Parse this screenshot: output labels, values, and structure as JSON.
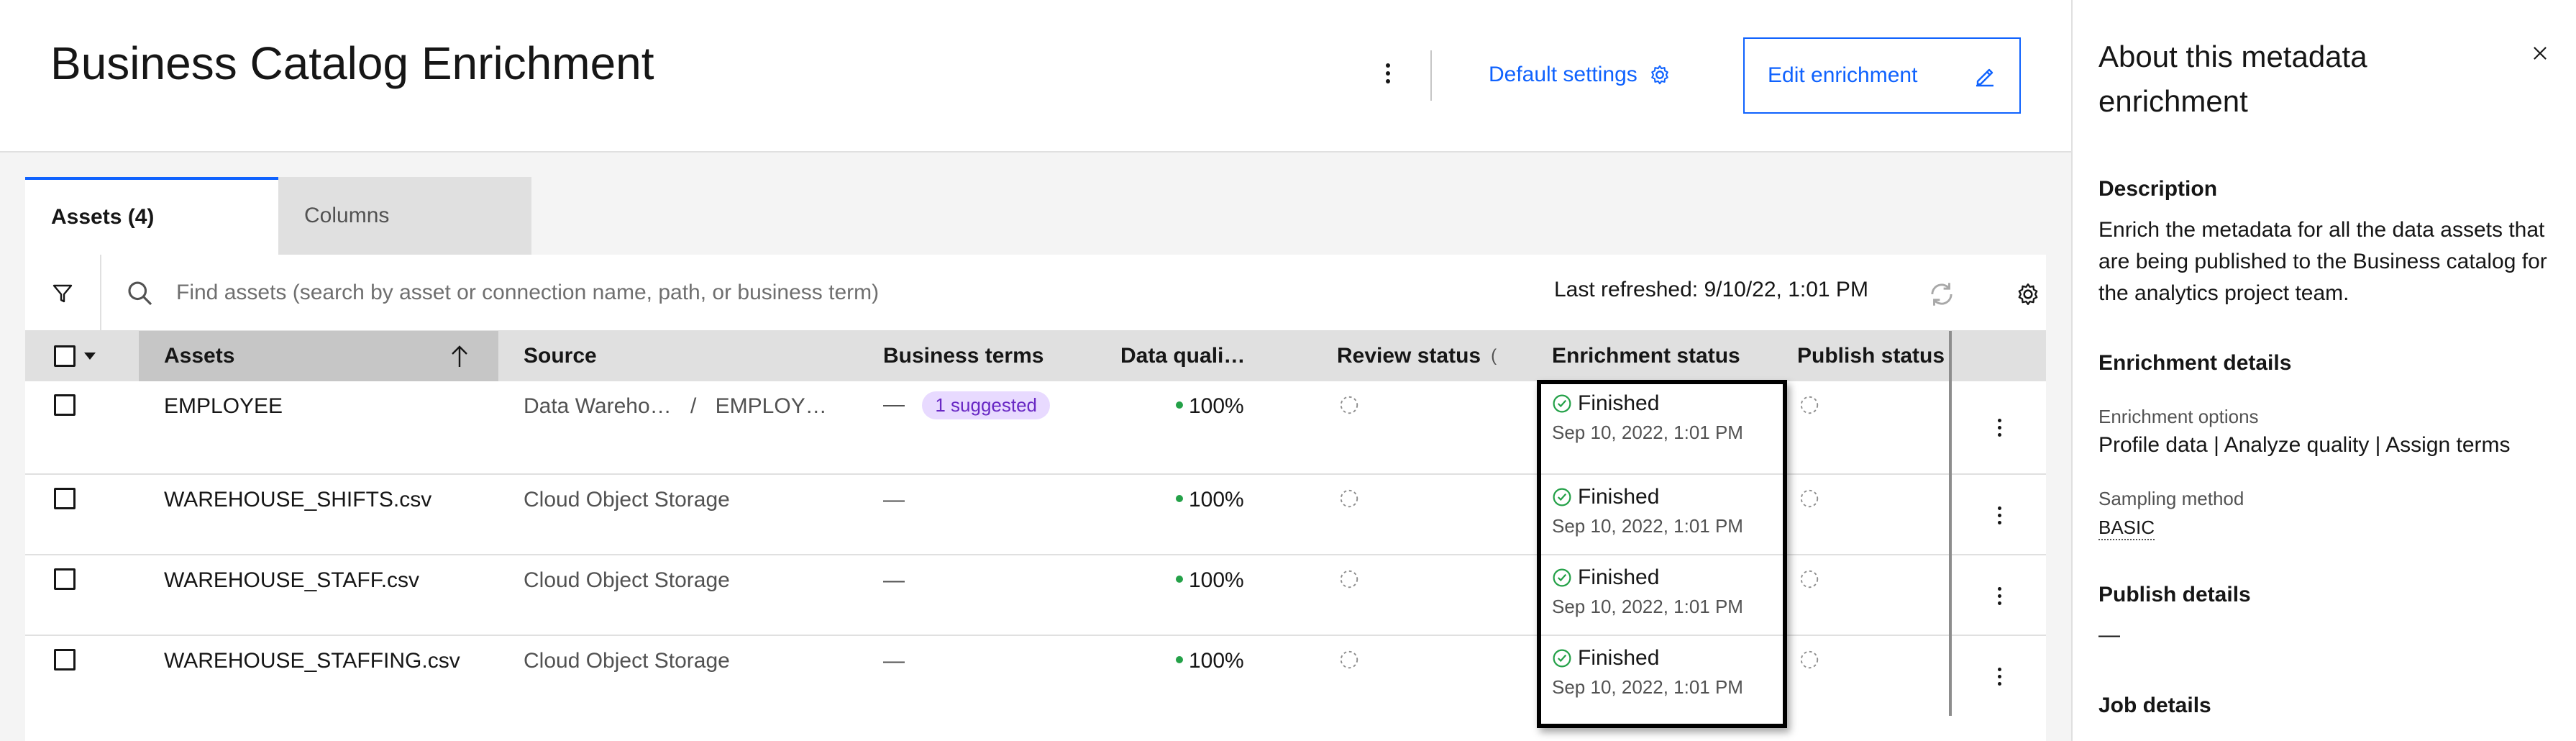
{
  "header": {
    "title": "Business Catalog Enrichment",
    "default_settings_label": "Default settings",
    "edit_label": "Edit enrichment"
  },
  "tabs": [
    {
      "label": "Assets (4)",
      "active": true
    },
    {
      "label": "Columns",
      "active": false
    }
  ],
  "toolbar": {
    "search_placeholder": "Find assets (search by asset or connection name, path, or business term)",
    "last_refreshed": "Last refreshed: 9/10/22, 1:01 PM"
  },
  "table": {
    "columns": {
      "assets": "Assets",
      "source": "Source",
      "business_terms": "Business terms",
      "data_quality": "Data quali…",
      "review_status": "Review status",
      "enrichment_status": "Enrichment status",
      "publish_status": "Publish status"
    },
    "rows": [
      {
        "asset": "EMPLOYEE",
        "source_a": "Data Wareho…",
        "source_sep": "/",
        "source_b": "EMPLOY…",
        "terms": "—",
        "terms_tag": "1 suggested",
        "quality": "100%",
        "enrichment": "Finished",
        "enrichment_time": "Sep 10, 2022, 1:01 PM"
      },
      {
        "asset": "WAREHOUSE_SHIFTS.csv",
        "source": "Cloud Object Storage",
        "terms": "—",
        "quality": "100%",
        "enrichment": "Finished",
        "enrichment_time": "Sep 10, 2022, 1:01 PM"
      },
      {
        "asset": "WAREHOUSE_STAFF.csv",
        "source": "Cloud Object Storage",
        "terms": "—",
        "quality": "100%",
        "enrichment": "Finished",
        "enrichment_time": "Sep 10, 2022, 1:01 PM"
      },
      {
        "asset": "WAREHOUSE_STAFFING.csv",
        "source": "Cloud Object Storage",
        "terms": "—",
        "quality": "100%",
        "enrichment": "Finished",
        "enrichment_time": "Sep 10, 2022, 1:01 PM"
      }
    ]
  },
  "panel": {
    "title": "About this metadata enrichment",
    "description_heading": "Description",
    "description": "Enrich the metadata for all the data assets that are being published to the Business catalog for the analytics project team.",
    "enrichment_heading": "Enrichment details",
    "options_label": "Enrichment options",
    "options_value": "Profile data | Analyze quality | Assign terms",
    "sampling_label": "Sampling method",
    "sampling_value": "BASIC",
    "publish_heading": "Publish details",
    "publish_value": "—",
    "job_heading": "Job details"
  },
  "colors": {
    "primary": "#0f62fe",
    "success": "#24a148",
    "tag_bg": "#e8daff",
    "tag_text": "#6929c4"
  },
  "icons": [
    "overflow-menu-icon",
    "settings-icon",
    "edit-icon",
    "filter-icon",
    "search-icon",
    "refresh-icon",
    "sort-arrow-up-icon",
    "checkmark-circle-icon",
    "pending-circle-icon",
    "close-icon"
  ]
}
